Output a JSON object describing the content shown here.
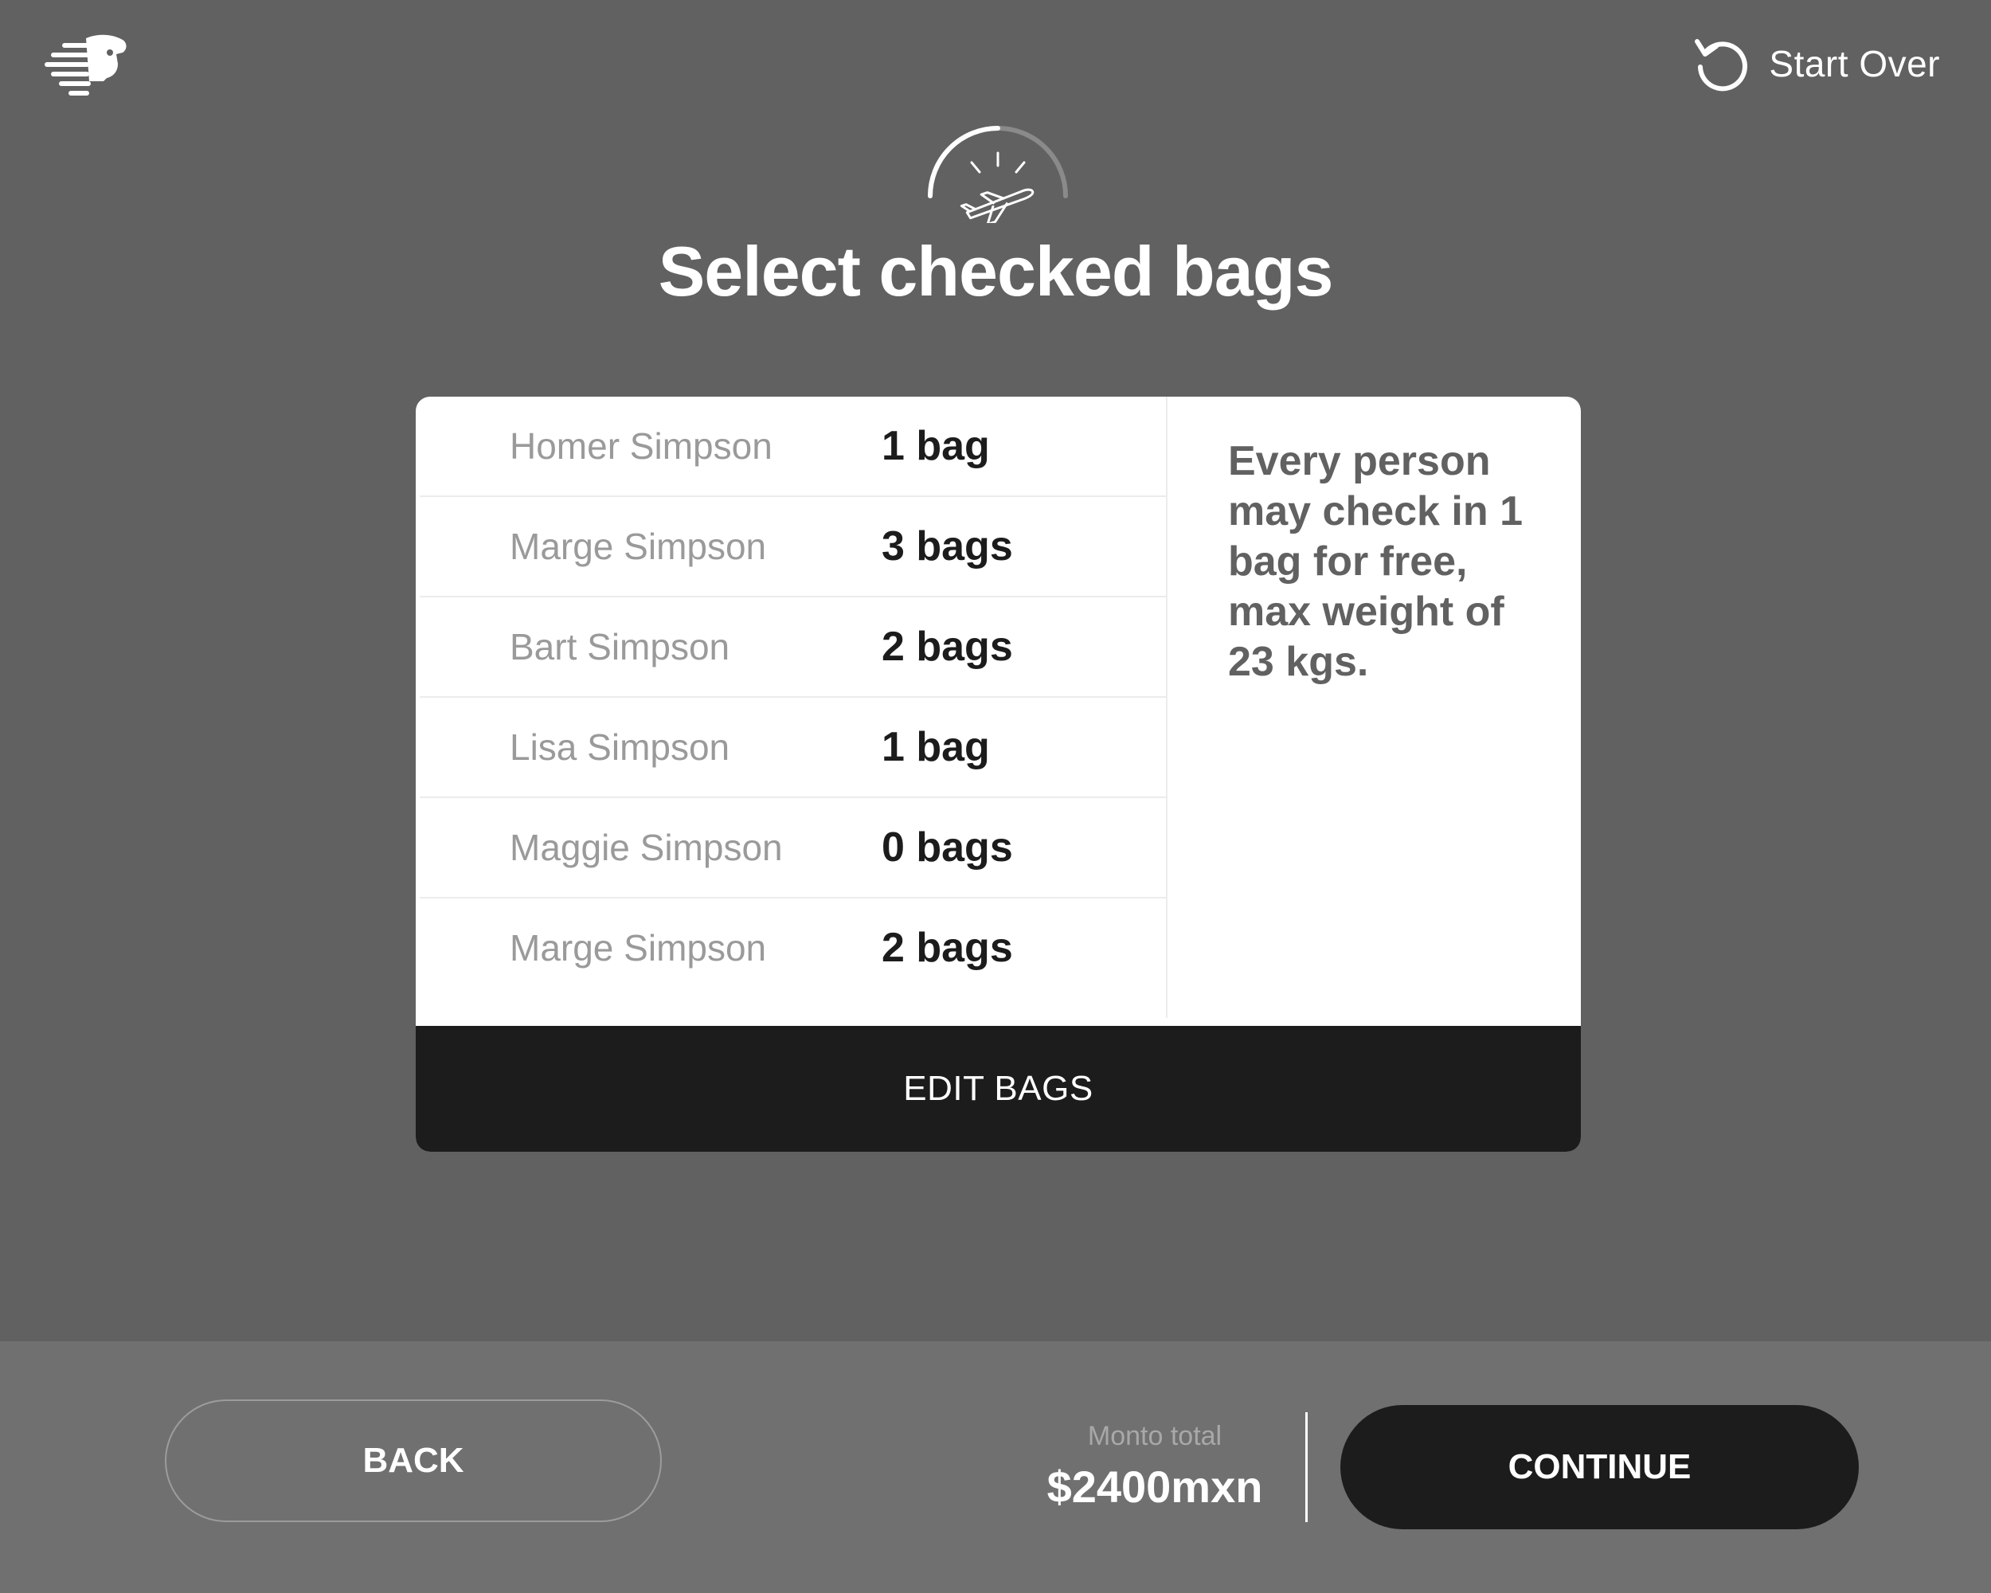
{
  "header": {
    "logo_icon": "eagle-warrior-logo-icon",
    "start_over_label": "Start Over",
    "start_over_icon": "restart-icon"
  },
  "hero": {
    "icon": "departing-plane-progress-icon",
    "title": "Select checked bags"
  },
  "passengers": [
    {
      "name": "Homer Simpson",
      "bags": "1 bag"
    },
    {
      "name": "Marge Simpson",
      "bags": "3 bags"
    },
    {
      "name": "Bart Simpson",
      "bags": "2 bags"
    },
    {
      "name": "Lisa Simpson",
      "bags": "1 bag"
    },
    {
      "name": "Maggie Simpson",
      "bags": "0 bags"
    },
    {
      "name": "Marge Simpson",
      "bags": "2 bags"
    }
  ],
  "info_text": "Every person may check in 1 bag for free, max weight of 23 kgs.",
  "edit_bags_label": "EDIT BAGS",
  "footer": {
    "back_label": "BACK",
    "total_label": "Monto total",
    "total_value": "$2400mxn",
    "continue_label": "CONTINUE"
  },
  "colors": {
    "background": "#616161",
    "footer_background": "#707070",
    "dark": "#1c1c1c",
    "card": "#ffffff"
  }
}
